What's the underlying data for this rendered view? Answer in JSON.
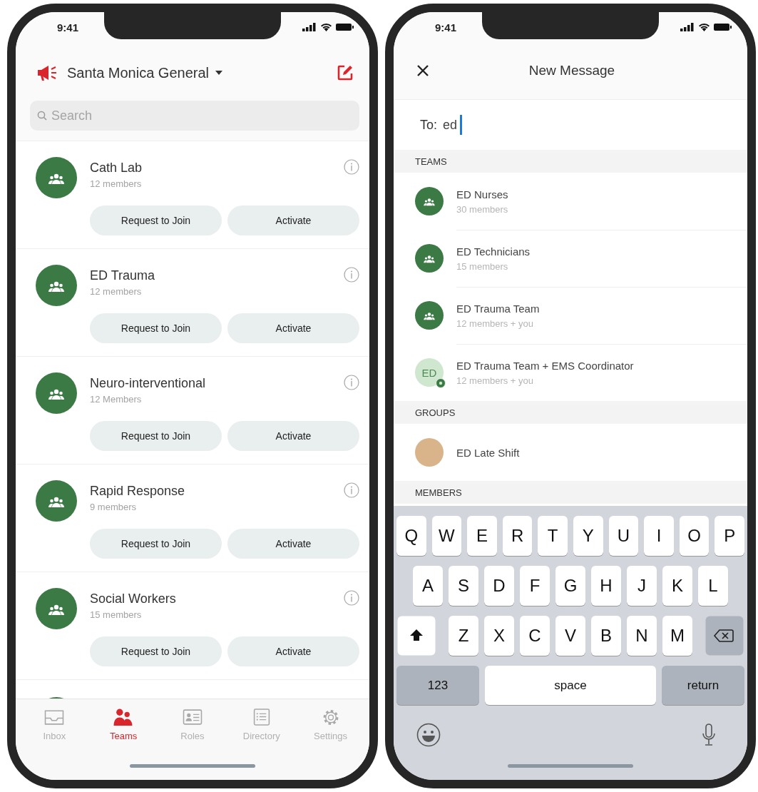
{
  "left_screen": {
    "status_bar": {
      "time": "9:41"
    },
    "header": {
      "title": "Santa Monica General"
    },
    "search": {
      "placeholder": "Search"
    },
    "teams": [
      {
        "kind": "full",
        "name": "Cath Lab",
        "members": "12 members",
        "buttons": [
          "Request to Join",
          "Activate"
        ]
      },
      {
        "kind": "full",
        "name": "ED Trauma",
        "members": "12 members",
        "buttons": [
          "Request to Join",
          "Activate"
        ]
      },
      {
        "kind": "full",
        "name": "Neuro-interventional",
        "members": "12 Members",
        "buttons": [
          "Request to Join",
          "Activate"
        ]
      },
      {
        "kind": "full",
        "name": "Rapid Response",
        "members": "9 members",
        "buttons": [
          "Request to Join",
          "Activate"
        ]
      },
      {
        "kind": "full",
        "name": "Social Workers",
        "members": "15 members",
        "buttons": [
          "Request to Join",
          "Activate"
        ]
      },
      {
        "kind": "cut"
      }
    ],
    "tab_bar": [
      {
        "kind": "inbox",
        "label": "Inbox",
        "selected": false
      },
      {
        "kind": "teams",
        "label": "Teams",
        "selected": true
      },
      {
        "kind": "roles",
        "label": "Roles",
        "selected": false
      },
      {
        "kind": "directory",
        "label": "Directory",
        "selected": false
      },
      {
        "kind": "settings",
        "label": "Settings",
        "selected": false
      }
    ]
  },
  "right_screen": {
    "status_bar": {
      "time": "9:41"
    },
    "nav": {
      "title": "New Message"
    },
    "to_field": {
      "label": "To:",
      "value": "ed"
    },
    "sections": [
      {
        "heading": "TEAMS",
        "items": [
          {
            "kind": "team",
            "name": "ED Nurses",
            "detail": "30 members"
          },
          {
            "kind": "team",
            "name": "ED Technicians",
            "detail": "15 members"
          },
          {
            "kind": "team",
            "name": "ED Trauma Team",
            "detail": "12 members + you"
          },
          {
            "kind": "initials",
            "initials": "ED",
            "name": "ED Trauma Team + EMS Coordinator",
            "detail": "12 members + you"
          }
        ]
      },
      {
        "heading": "GROUPS",
        "items": [
          {
            "kind": "photo",
            "name": "ED Late Shift"
          }
        ]
      },
      {
        "heading": "MEMBERS"
      }
    ],
    "keyboard": {
      "rows": [
        [
          "Q",
          "W",
          "E",
          "R",
          "T",
          "Y",
          "U",
          "I",
          "O",
          "P"
        ],
        [
          "A",
          "S",
          "D",
          "F",
          "G",
          "H",
          "J",
          "K",
          "L"
        ],
        [
          "Z",
          "X",
          "C",
          "V",
          "B",
          "N",
          "M"
        ]
      ],
      "bottom": [
        {
          "kind": "mode",
          "label": "123"
        },
        {
          "kind": "space",
          "label": "space"
        },
        {
          "kind": "mode",
          "label": "return"
        }
      ]
    }
  }
}
